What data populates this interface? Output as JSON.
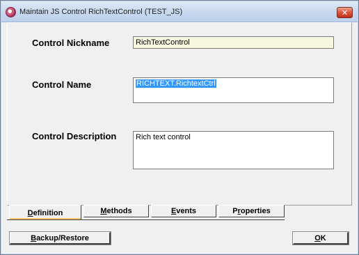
{
  "window": {
    "title": "Maintain JS Control RichTextControl (TEST_JS)",
    "app_icon": "app-icon",
    "close_icon": "close-x-icon",
    "close_glyph": "✕"
  },
  "form": {
    "nickname_label": "Control Nickname",
    "nickname_value": "RichTextControl",
    "name_label": "Control Name",
    "name_value": "RICHTEXT.RichtextCtrl",
    "description_label": "Control Description",
    "description_value": "Rich text control"
  },
  "tabs": [
    {
      "mnemonic": "D",
      "rest": "efinition",
      "active": true
    },
    {
      "mnemonic": "M",
      "rest": "ethods",
      "active": false
    },
    {
      "mnemonic": "E",
      "rest": "vents",
      "active": false
    },
    {
      "pre": "P",
      "mnemonic": "r",
      "rest": "operties",
      "active": false
    }
  ],
  "buttons": {
    "backup": {
      "mnemonic": "B",
      "rest": "ackup/Restore"
    },
    "ok": {
      "mnemonic": "O",
      "rest": "K"
    }
  },
  "colors": {
    "nickname_bg": "#f7f7df",
    "selection": "#3399ff",
    "active_tab_accent": "#f5c266"
  }
}
